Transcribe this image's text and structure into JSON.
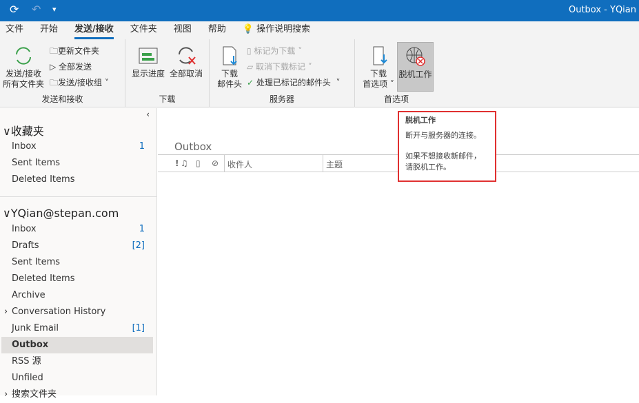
{
  "window": {
    "title": "Outbox - YQian"
  },
  "quick_access": {
    "sync": "⟳",
    "undo": "↶",
    "customize": "▾"
  },
  "tabs": [
    "文件",
    "开始",
    "发送/接收",
    "文件夹",
    "视图",
    "帮助"
  ],
  "search": {
    "label": "操作说明搜索"
  },
  "ribbon": {
    "send_receive": {
      "label": "发送和接收",
      "send_all_l1": "发送/接收",
      "send_all_l2": "所有文件夹",
      "update_folder": "更新文件夹",
      "send_all": "全部发送",
      "groups": "发送/接收组"
    },
    "download": {
      "label": "下载",
      "progress": "显示进度",
      "cancel_all": "全部取消"
    },
    "server": {
      "label": "服务器",
      "headers_l1": "下载",
      "headers_l2": "邮件头",
      "mark_download": "标记为下载",
      "unmark": "取消下载标记",
      "process": "处理已标记的邮件头"
    },
    "prefs": {
      "label": "首选项",
      "dl_l1": "下载",
      "dl_l2": "首选项",
      "offline": "脱机工作"
    }
  },
  "nav": {
    "favorites": {
      "title": "收藏夹",
      "items": [
        {
          "label": "Inbox",
          "count": "1"
        },
        {
          "label": "Sent Items",
          "count": ""
        },
        {
          "label": "Deleted Items",
          "count": ""
        }
      ]
    },
    "account": {
      "title": "YQian@stepan.com",
      "items": [
        {
          "label": "Inbox",
          "count": "1"
        },
        {
          "label": "Drafts",
          "count": "[2]"
        },
        {
          "label": "Sent Items",
          "count": ""
        },
        {
          "label": "Deleted Items",
          "count": ""
        },
        {
          "label": "Archive",
          "count": ""
        },
        {
          "label": "Conversation History",
          "count": ""
        },
        {
          "label": "Junk Email",
          "count": "[1]"
        },
        {
          "label": "Outbox",
          "count": ""
        },
        {
          "label": "RSS 源",
          "count": ""
        },
        {
          "label": "Unfiled",
          "count": ""
        },
        {
          "label": "搜索文件夹",
          "count": ""
        }
      ]
    }
  },
  "main": {
    "folder": "Outbox",
    "cols": {
      "importance": "!",
      "to": "收件人",
      "subject": "主题"
    }
  },
  "tooltip": {
    "title": "脱机工作",
    "line1": "断开与服务器的连接。",
    "line2": "如果不想接收新邮件，",
    "line3": "请脱机工作。"
  }
}
